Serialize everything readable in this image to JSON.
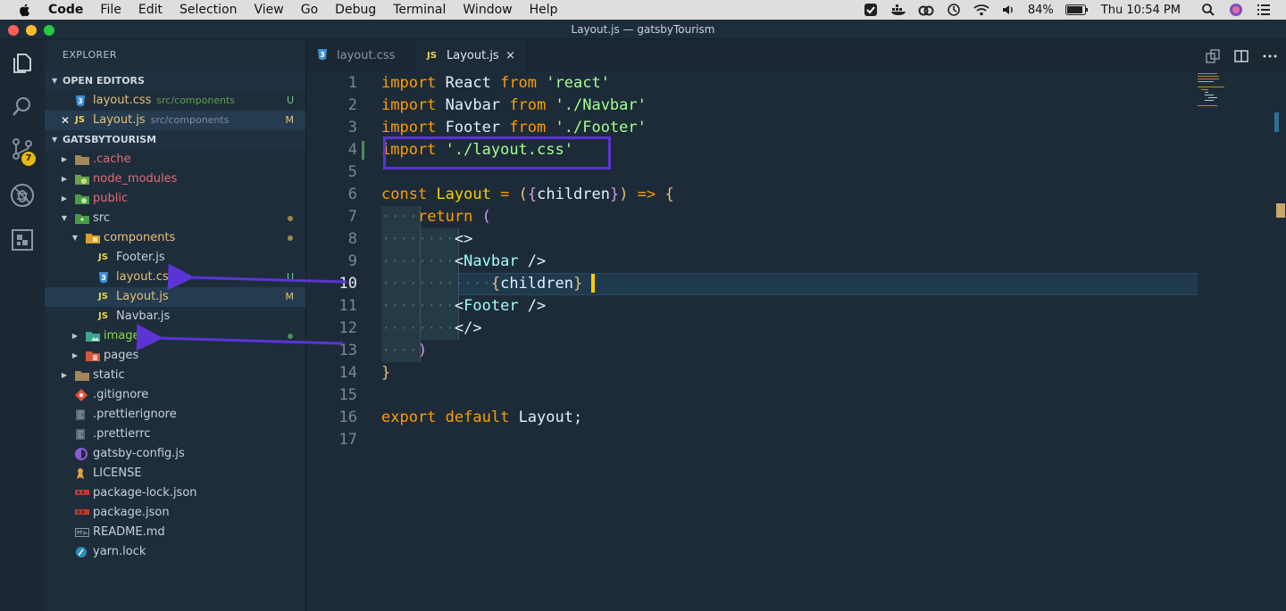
{
  "menubar": {
    "app": "Code",
    "items": [
      "File",
      "Edit",
      "Selection",
      "View",
      "Go",
      "Debug",
      "Terminal",
      "Window",
      "Help"
    ],
    "battery": "84%",
    "clock": "Thu 10:54 PM"
  },
  "window": {
    "title": "Layout.js — gatsbyTourism"
  },
  "activity": {
    "scm_badge": "7"
  },
  "sidebar": {
    "title": "EXPLORER",
    "open_editors": {
      "header": "OPEN EDITORS",
      "items": [
        {
          "name": "layout.css",
          "path": "src/components",
          "mark": "U"
        },
        {
          "name": "Layout.js",
          "path": "src/components",
          "mark": "M",
          "close": "✕"
        }
      ]
    },
    "project": {
      "header": "GATSBYTOURISM",
      "tree": [
        {
          "name": ".cache"
        },
        {
          "name": "node_modules"
        },
        {
          "name": "public"
        },
        {
          "name": "src"
        },
        {
          "name": "components"
        },
        {
          "name": "Footer.js"
        },
        {
          "name": "layout.css",
          "mark": "U"
        },
        {
          "name": "Layout.js",
          "mark": "M"
        },
        {
          "name": "Navbar.js"
        },
        {
          "name": "images"
        },
        {
          "name": "pages"
        },
        {
          "name": "static"
        },
        {
          "name": ".gitignore"
        },
        {
          "name": ".prettierignore"
        },
        {
          "name": ".prettierrc"
        },
        {
          "name": "gatsby-config.js"
        },
        {
          "name": "LICENSE"
        },
        {
          "name": "package-lock.json"
        },
        {
          "name": "package.json"
        },
        {
          "name": "README.md"
        },
        {
          "name": "yarn.lock"
        }
      ]
    }
  },
  "tabs": [
    {
      "label": "layout.css",
      "icon": "css-file-icon"
    },
    {
      "label": "Layout.js",
      "icon": "js-file-icon",
      "close": "×"
    }
  ],
  "editor": {
    "line_numbers": [
      "1",
      "2",
      "3",
      "4",
      "5",
      "6",
      "7",
      "8",
      "9",
      "10",
      "11",
      "12",
      "13",
      "14",
      "15",
      "16",
      "17"
    ],
    "current_line": "10",
    "lines": [
      [
        [
          "k",
          "import"
        ],
        [
          "p",
          " React "
        ],
        [
          "k",
          "from"
        ],
        [
          "p",
          " "
        ],
        [
          "s",
          "'react'"
        ]
      ],
      [
        [
          "k",
          "import"
        ],
        [
          "p",
          " Navbar "
        ],
        [
          "k",
          "from"
        ],
        [
          "p",
          " "
        ],
        [
          "s",
          "'./Navbar'"
        ]
      ],
      [
        [
          "k",
          "import"
        ],
        [
          "p",
          " Footer "
        ],
        [
          "k",
          "from"
        ],
        [
          "p",
          " "
        ],
        [
          "s",
          "'./Footer'"
        ]
      ],
      [
        [
          "k",
          "import"
        ],
        [
          "p",
          " "
        ],
        [
          "s",
          "'./layout.css'"
        ]
      ],
      [],
      [
        [
          "k",
          "const"
        ],
        [
          "p",
          " "
        ],
        [
          "f",
          "Layout"
        ],
        [
          "p",
          " "
        ],
        [
          "k",
          "="
        ],
        [
          "p",
          " "
        ],
        [
          "b1",
          "("
        ],
        [
          "b2",
          "{"
        ],
        [
          "p",
          "children"
        ],
        [
          "b2",
          "}"
        ],
        [
          "b1",
          ")"
        ],
        [
          "p",
          " "
        ],
        [
          "k",
          "=>"
        ],
        [
          "p",
          " "
        ],
        [
          "b1",
          "{"
        ]
      ],
      [
        [
          "ws",
          "····"
        ],
        [
          "k",
          "return"
        ],
        [
          "p",
          " "
        ],
        [
          "b2",
          "("
        ]
      ],
      [
        [
          "ws",
          "········"
        ],
        [
          "p",
          "<>"
        ]
      ],
      [
        [
          "ws",
          "········"
        ],
        [
          "p",
          "<"
        ],
        [
          "tag",
          "Navbar"
        ],
        [
          "p",
          " />"
        ]
      ],
      [
        [
          "ws",
          "············"
        ],
        [
          "b1",
          "{"
        ],
        [
          "p",
          "children"
        ],
        [
          "b1",
          "}"
        ]
      ],
      [
        [
          "ws",
          "········"
        ],
        [
          "p",
          "<"
        ],
        [
          "tag",
          "Footer"
        ],
        [
          "p",
          " />"
        ]
      ],
      [
        [
          "ws",
          "········"
        ],
        [
          "p",
          "</>"
        ]
      ],
      [
        [
          "ws",
          "····"
        ],
        [
          "b2",
          ")"
        ]
      ],
      [
        [
          "b1",
          "}"
        ]
      ],
      [],
      [
        [
          "k",
          "export"
        ],
        [
          "p",
          " "
        ],
        [
          "k",
          "default"
        ],
        [
          "p",
          " Layout;"
        ]
      ],
      []
    ]
  },
  "colors": {
    "accent_box": "#5b34d6",
    "arrow": "#5b34d6",
    "badge": "#e5b80c"
  }
}
